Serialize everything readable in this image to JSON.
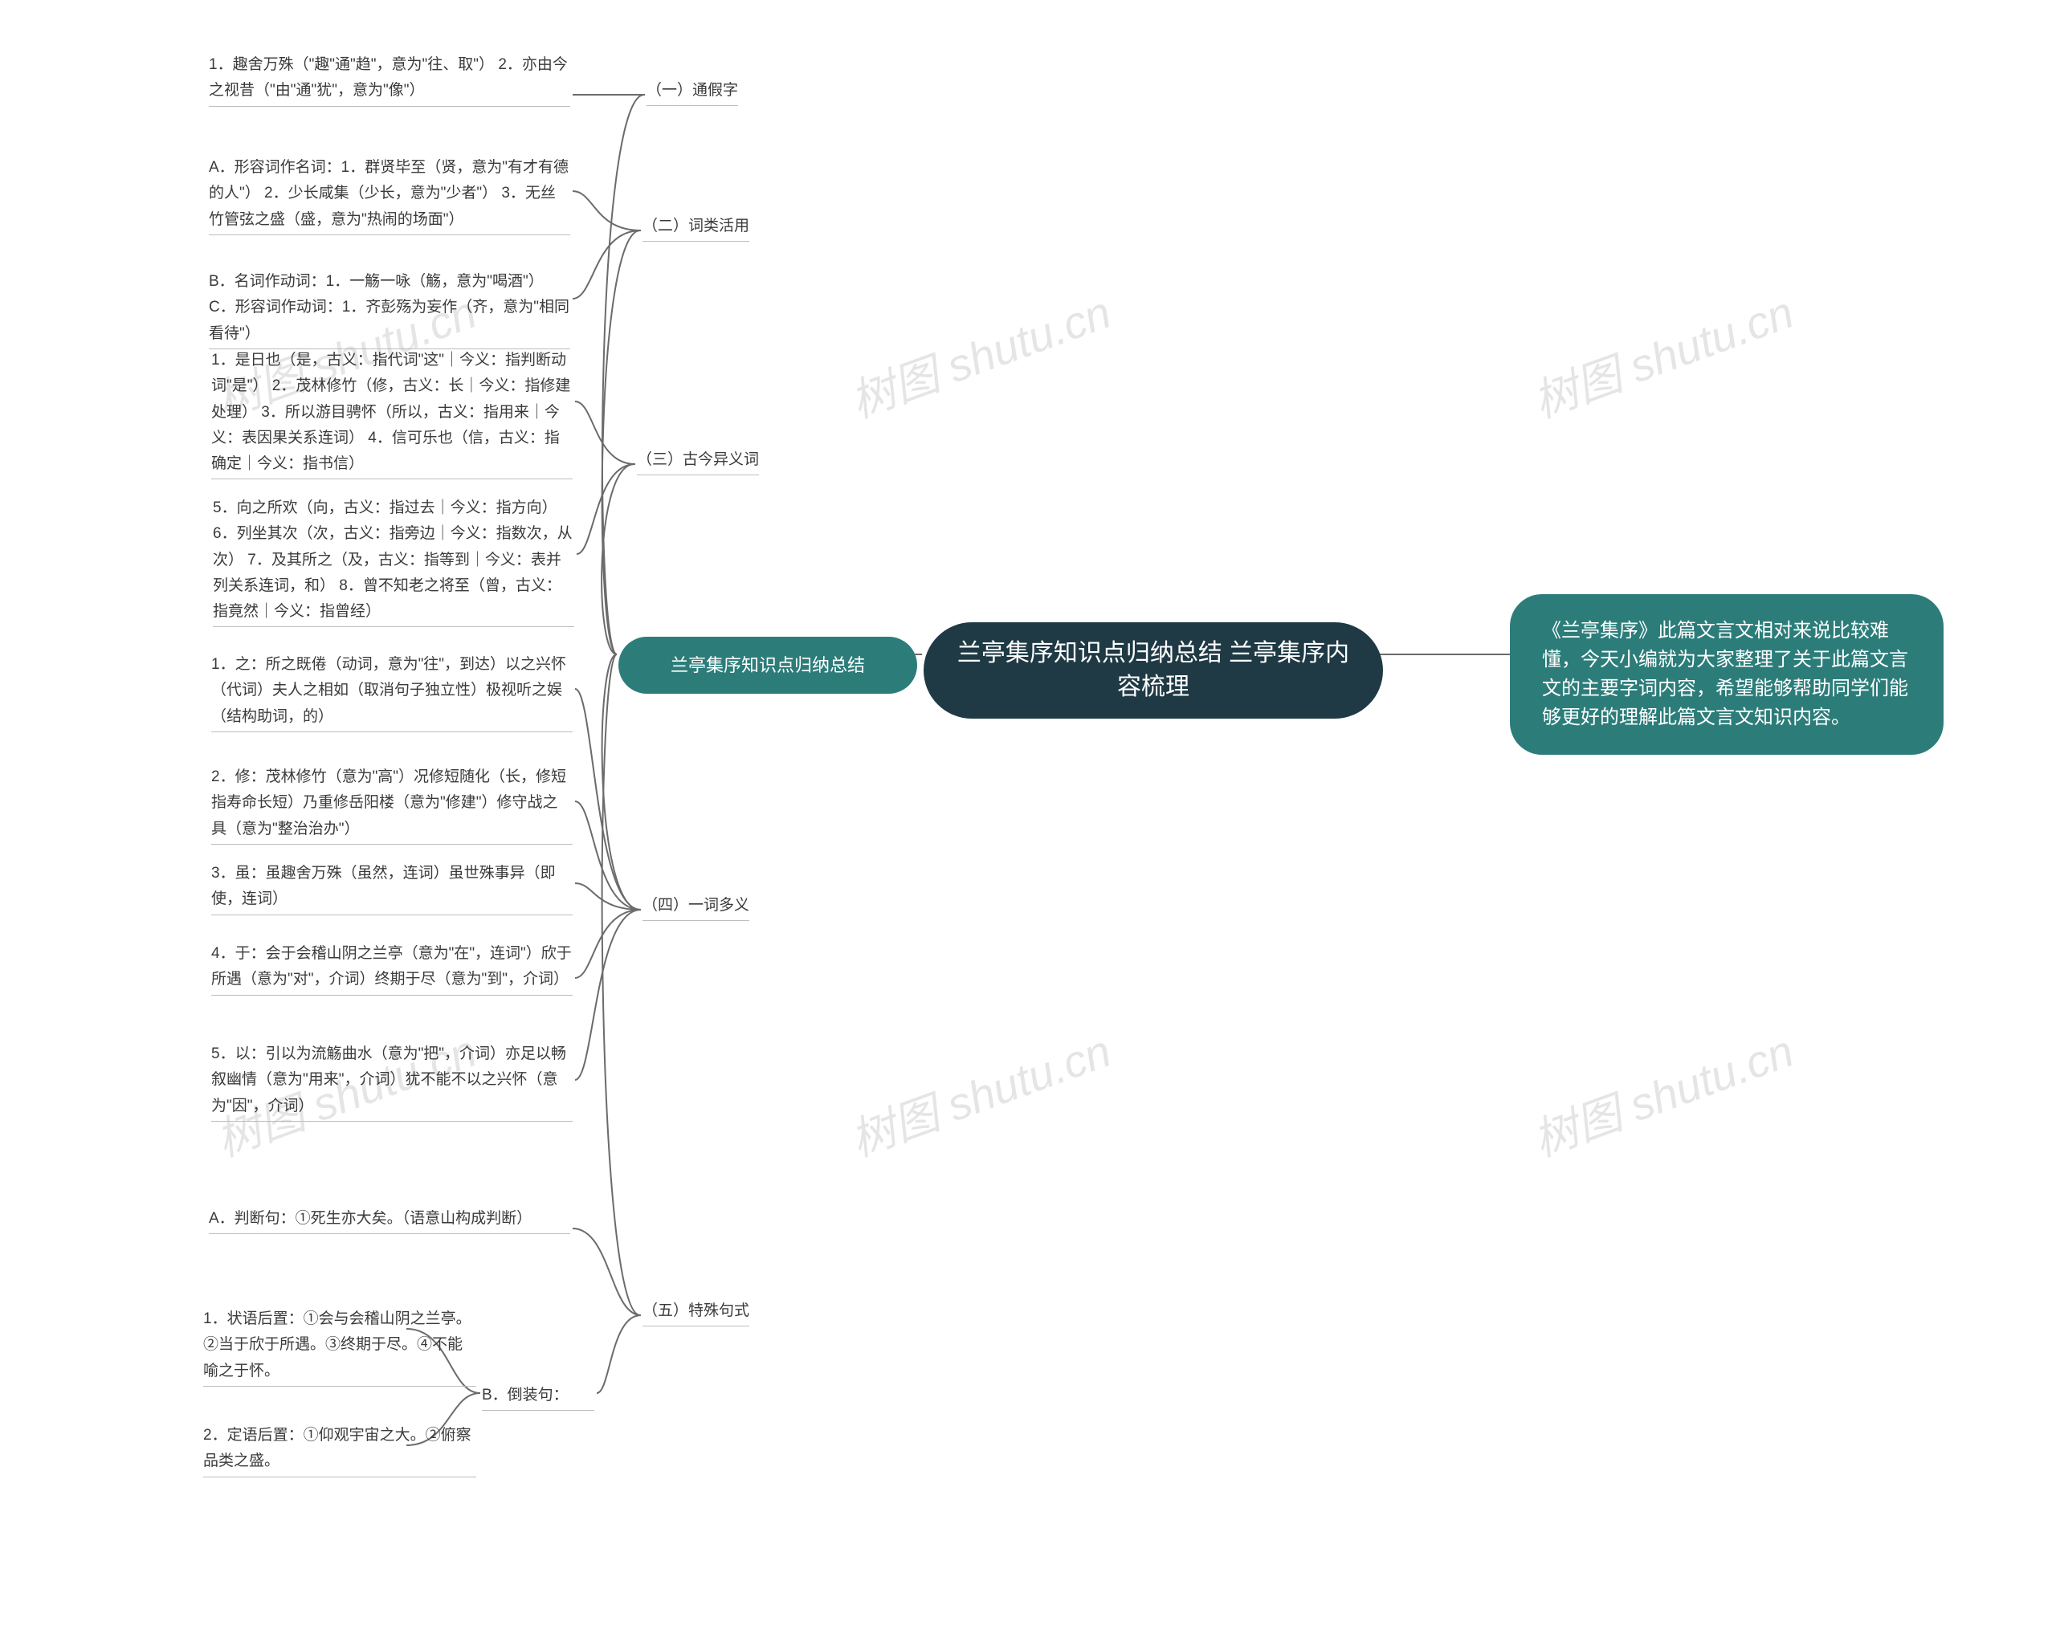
{
  "center_title": "兰亭集序知识点归纳总结 兰亭集序内容梳理",
  "description": "《兰亭集序》此篇文言文相对来说比较难懂，今天小编就为大家整理了关于此篇文言文的主要字词内容，希望能够帮助同学们能够更好的理解此篇文言文知识内容。",
  "left_title": "兰亭集序知识点归纳总结",
  "categories": {
    "c1": "（一）通假字",
    "c2": "（二）词类活用",
    "c3": "（三）古今异义词",
    "c4": "（四）一词多义",
    "c5": "（五）特殊句式"
  },
  "details": {
    "d1": "1．趣舍万殊（\"趣\"通\"趋\"，意为\"往、取\"） 2．亦由今之视昔（\"由\"通\"犹\"，意为\"像\"）",
    "d2a": "A．形容词作名词：1．群贤毕至（贤，意为\"有才有德的人\"） 2．少长咸集（少长，意为\"少者\"） 3．无丝竹管弦之盛（盛，意为\"热闹的场面\"）",
    "d2b": "B．名词作动词：1．一觞一咏（觞，意为\"喝酒\"） C．形容词作动词：1．齐彭殇为妄作（齐，意为\"相同看待\"）",
    "d3a": "1．是日也（是，古义：指代词\"这\"｜今义：指判断动词\"是\"） 2．茂林修竹（修，古义：长｜今义：指修建处理） 3．所以游目骋怀（所以，古义：指用来｜今义：表因果关系连词） 4．信可乐也（信，古义：指确定｜今义：指书信）",
    "d3b": "5．向之所欢（向，古义：指过去｜今义：指方向） 6．列坐其次（次，古义：指旁边｜今义：指数次，从次） 7．及其所之（及，古义：指等到｜今义：表并列关系连词，和） 8．曾不知老之将至（曾，古义：指竟然｜今义：指曾经）",
    "d4a": "1．之：所之既倦（动词，意为\"往\"，到达）以之兴怀（代词）夫人之相如（取消句子独立性）极视听之娱（结构助词，的）",
    "d4b": "2．修：茂林修竹（意为\"高\"）况修短随化（长，修短指寿命长短）乃重修岳阳楼（意为\"修建\"）修守战之具（意为\"整治治办\"）",
    "d4c": "3．虽：虽趣舍万殊（虽然，连词）虽世殊事异（即使，连词）",
    "d4d": "4．于：会于会稽山阴之兰亭（意为\"在\"，连词\"）欣于所遇（意为\"对\"，介词）终期于尽（意为\"到\"，介词）",
    "d4e": "5．以：引以为流觞曲水（意为\"把\"，介词）亦足以畅叙幽情（意为\"用来\"，介词）犹不能不以之兴怀（意为\"因\"，介词）",
    "d5a": "A．判断句：①死生亦大矣。（语意山构成判断）",
    "d5bLabel": "B．倒装句：",
    "d5b1": "1．状语后置：①会与会稽山阴之兰亭。②当于欣于所遇。③终期于尽。④不能喻之于怀。",
    "d5b2": "2．定语后置：①仰观宇宙之大。②俯察品类之盛。"
  },
  "watermark": "树图 shutu.cn"
}
